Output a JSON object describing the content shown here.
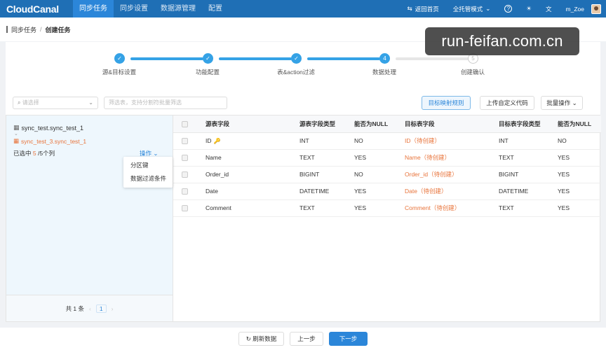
{
  "app": {
    "logo": "CloudCanal"
  },
  "nav": {
    "items": [
      "同步任务",
      "同步设置",
      "数据源管理",
      "配置"
    ],
    "right": {
      "back": "返回首页",
      "mode": "全托管模式",
      "help": "?",
      "user": "m_Zoe"
    }
  },
  "breadcrumb": [
    "同步任务",
    "/",
    "创建任务"
  ],
  "watermark": "run-feifan.com.cn",
  "steps": [
    {
      "num": "✓",
      "label": "源&目标设置",
      "state": "done"
    },
    {
      "num": "✓",
      "label": "功能配置",
      "state": "done"
    },
    {
      "num": "✓",
      "label": "表&action过滤",
      "state": "done"
    },
    {
      "num": "4",
      "label": "数据处理",
      "state": "current"
    },
    {
      "num": "5",
      "label": "创建确认",
      "state": "todo"
    }
  ],
  "toolbar": {
    "select_placeholder": "请选择",
    "search_placeholder": "筛选表，支持分割符批量筛选",
    "btn_mapping": "目标映射规则",
    "btn_upload": "上传自定义代码",
    "btn_batch": "批量操作"
  },
  "left": {
    "source_table": "sync_test.sync_test_1",
    "target_table": "sync_test_3.sync_test_1",
    "selected_prefix": "已选中",
    "selected_count": "5",
    "selected_suffix": "/5个列",
    "op": "操作",
    "menu": [
      "分区键",
      "数据过滤条件"
    ],
    "pager_total": "共 1 条",
    "pager_page": "1"
  },
  "table": {
    "headers": [
      "源表字段",
      "源表字段类型",
      "能否为NULL",
      "目标表字段",
      "目标表字段类型",
      "能否为NULL"
    ],
    "rows": [
      {
        "src": "ID",
        "src_type": "INT",
        "src_null": "NO",
        "tgt": "ID（待创建）",
        "tgt_type": "INT",
        "tgt_null": "NO"
      },
      {
        "src": "Name",
        "src_type": "TEXT",
        "src_null": "YES",
        "tgt": "Name（待创建）",
        "tgt_type": "TEXT",
        "tgt_null": "YES"
      },
      {
        "src": "Order_id",
        "src_type": "BIGINT",
        "src_null": "NO",
        "tgt": "Order_id（待创建）",
        "tgt_type": "BIGINT",
        "tgt_null": "YES"
      },
      {
        "src": "Date",
        "src_type": "DATETIME",
        "src_null": "YES",
        "tgt": "Date（待创建）",
        "tgt_type": "DATETIME",
        "tgt_null": "YES"
      },
      {
        "src": "Comment",
        "src_type": "TEXT",
        "src_null": "YES",
        "tgt": "Comment（待创建）",
        "tgt_type": "TEXT",
        "tgt_null": "YES"
      }
    ]
  },
  "footer": {
    "refresh": "刷新数据",
    "prev": "上一步",
    "next": "下一步"
  }
}
